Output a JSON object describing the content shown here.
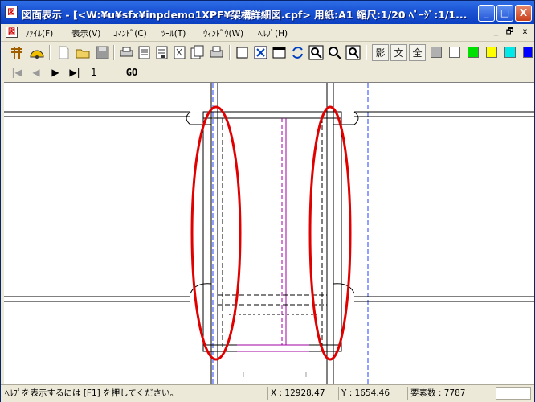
{
  "window": {
    "title": "図面表示 - [<W:¥u¥sfx¥inpdemo1XPF¥架構詳細図.cpf>  用紙:A1  縮尺:1/20  ﾍﾟｰｼﾞ:1/1...",
    "app_icon_text": "図"
  },
  "title_buttons": {
    "minimize": "_",
    "maximize": "□",
    "close": "X"
  },
  "menu": {
    "items": [
      "ﾌｧｲﾙ(F)",
      "表示(V)",
      "ｺﾏﾝﾄﾞ(C)",
      "ﾂｰﾙ(T)",
      "ｳｨﾝﾄﾞｳ(W)",
      "ﾍﾙﾌﾟ(H)"
    ],
    "mdi_minimize": "_",
    "mdi_restore": "🗗",
    "mdi_close": "x"
  },
  "toolbar": {
    "text_buttons": [
      "影",
      "文",
      "全"
    ],
    "colors": [
      "#b0b0b0",
      "#ffffff",
      "#00e000",
      "#ffff00",
      "#00e8e8",
      "#0000ff"
    ]
  },
  "nav": {
    "page_value": "1",
    "go_label": "GO"
  },
  "status": {
    "help": "ﾍﾙﾌﾟを表示するには [F1] を押してください。",
    "x": "X : 12928.47",
    "y": "Y : 1654.46",
    "elements": "要素数 : 7787"
  }
}
